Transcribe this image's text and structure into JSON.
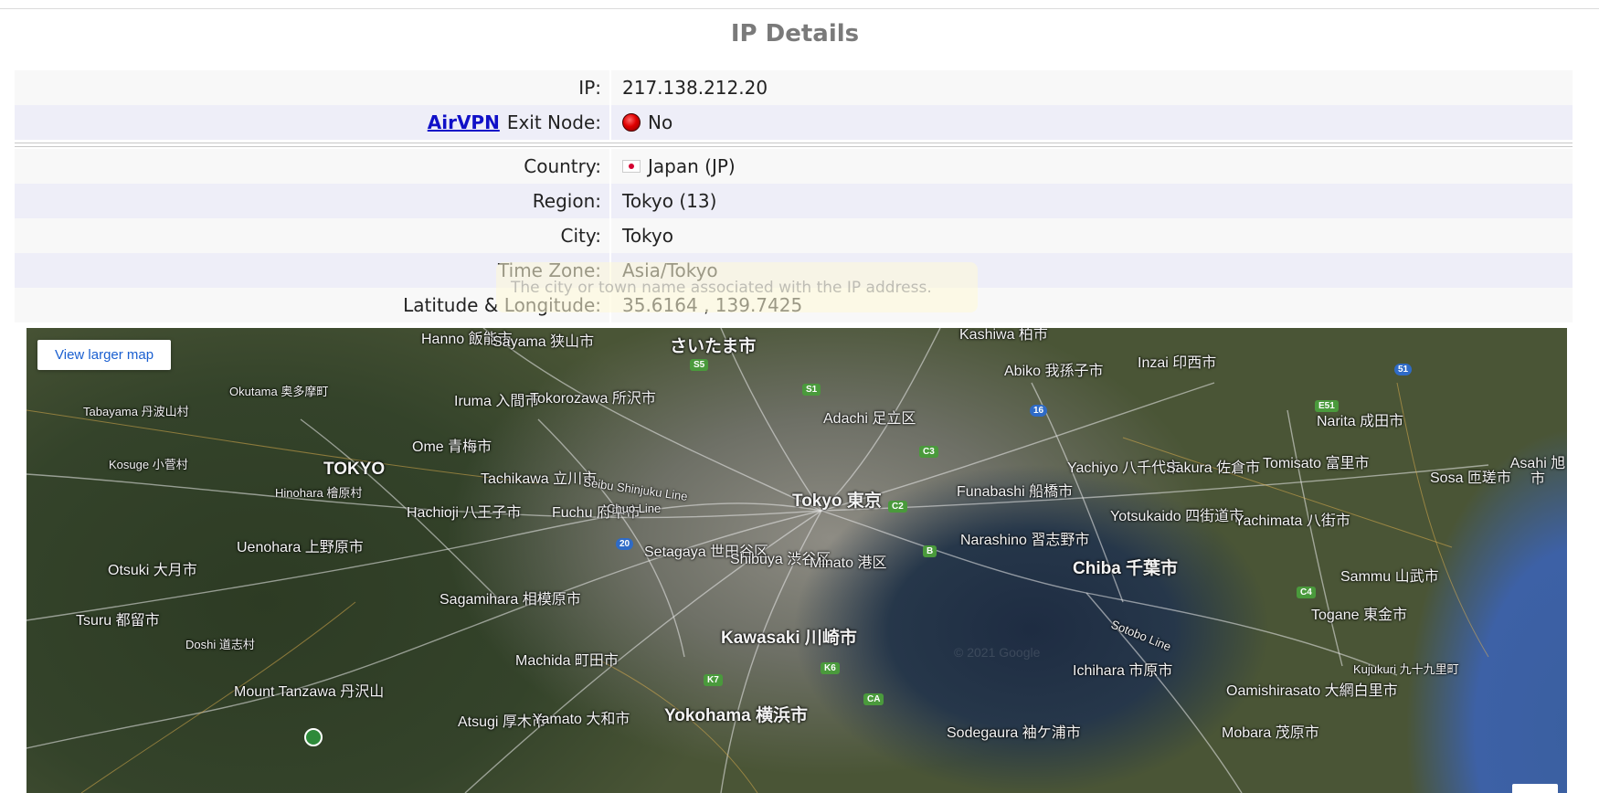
{
  "page": {
    "title": "IP Details"
  },
  "details": {
    "ip": {
      "label": "IP:",
      "value": "217.138.212.20"
    },
    "exit_node": {
      "link": "AirVPN",
      "label": "Exit Node:",
      "value": "No",
      "status_color": "#e00000"
    },
    "country": {
      "label": "Country:",
      "value": "Japan (JP)",
      "flag_icon": "japan-flag-icon"
    },
    "region": {
      "label": "Region:",
      "value": "Tokyo (13)"
    },
    "city": {
      "label": "City:",
      "value": "Tokyo"
    },
    "timezone": {
      "label": "Time Zone:",
      "value": "Asia/Tokyo"
    },
    "latlng": {
      "label": "Latitude & Longitude:",
      "value": "35.6164 , 139.7425"
    }
  },
  "tooltip": {
    "text": "The city or town name associated with the IP address."
  },
  "map": {
    "view_larger": "View larger map",
    "copyright": "© 2021 Google",
    "labels": [
      "Hanno 飯能市",
      "Sayama 狭山市",
      "さいたま市",
      "Kashiwa 柏市",
      "Inzai 印西市",
      "Okutama 奥多摩町",
      "Tabayama 丹波山村",
      "Iruma 入間市",
      "Tokorozawa 所沢市",
      "Adachi 足立区",
      "Abiko 我孫子市",
      "Narita 成田市",
      "TOKYO",
      "Ome 青梅市",
      "Kosuge 小菅村",
      "Hinohara 檜原村",
      "Tachikawa 立川市",
      "Tokyo 東京",
      "Funabashi 船橋市",
      "Yachiyo 八千代市",
      "Sakura 佐倉市",
      "Tomisato 富里市",
      "Hachioji 八王子市",
      "Fuchu 府中市",
      "Setagaya 世田谷区",
      "Shibuya 渋谷区",
      "Minato 港区",
      "Narashino 習志野市",
      "Yotsukaido 四街道市",
      "Yachimata 八街市",
      "Uenohara 上野原市",
      "Otsuki 大月市",
      "Chiba 千葉市",
      "Sammu 山武市",
      "Sagamihara 相模原市",
      "Tsuru 都留市",
      "Doshi 道志村",
      "Mount Tanzawa 丹沢山",
      "Machida 町田市",
      "Kawasaki 川崎市",
      "Ichihara 市原市",
      "Oamishirasato 大網白里市",
      "Togane 東金市",
      "Kujukuri 九十九里町",
      "Atsugi 厚木市",
      "Yamato 大和市",
      "Yokohama 横浜市",
      "Sodegaura 袖ケ浦市",
      "Mobara 茂原市",
      "Sosa 匝瑳市",
      "Asahi 旭市",
      "Seibu Shinjuku Line",
      "Chuo Line",
      "Sotobo Line"
    ],
    "shields": [
      "S5",
      "S1",
      "16",
      "C3",
      "C2",
      "20",
      "B",
      "51",
      "E51",
      "C4",
      "K6",
      "K7",
      "CA"
    ]
  }
}
